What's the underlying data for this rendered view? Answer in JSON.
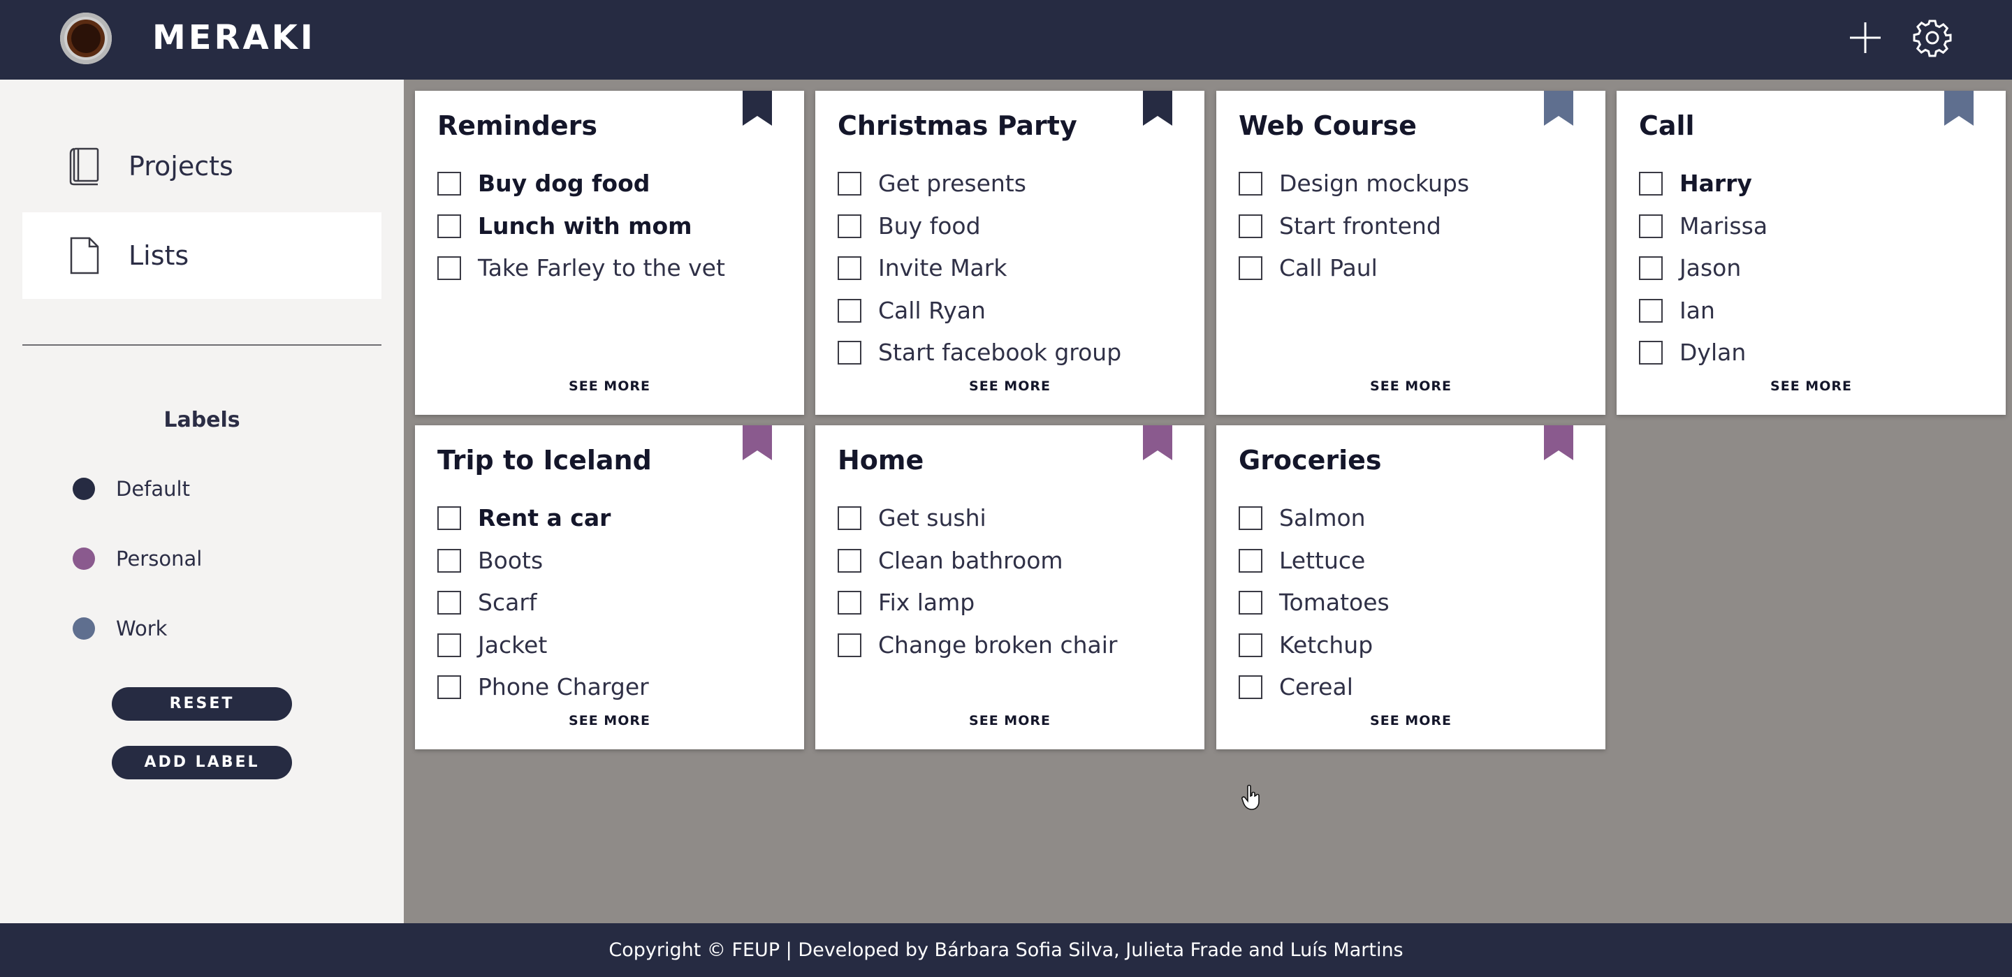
{
  "app": {
    "brand": "MERAKI"
  },
  "header": {
    "add_icon": "plus-icon",
    "settings_icon": "gear-icon"
  },
  "sidebar": {
    "nav": [
      {
        "label": "Projects",
        "icon": "book-icon",
        "active": false
      },
      {
        "label": "Lists",
        "icon": "document-icon",
        "active": true
      }
    ],
    "labels_title": "Labels",
    "labels": [
      {
        "name": "Default",
        "color": "#262b42"
      },
      {
        "name": "Personal",
        "color": "#8a5a8e"
      },
      {
        "name": "Work",
        "color": "#5f6f8f"
      }
    ],
    "reset_label": "RESET",
    "add_label_label": "ADD LABEL"
  },
  "lists": [
    {
      "title": "Reminders",
      "label_color": "#262b42",
      "items": [
        {
          "text": "Buy dog food",
          "bold": true
        },
        {
          "text": "Lunch with mom",
          "bold": true
        },
        {
          "text": "Take Farley to the vet",
          "bold": false
        }
      ],
      "see_more": "SEE MORE"
    },
    {
      "title": "Christmas Party",
      "label_color": "#262b42",
      "items": [
        {
          "text": "Get presents",
          "bold": false
        },
        {
          "text": "Buy food",
          "bold": false
        },
        {
          "text": "Invite Mark",
          "bold": false
        },
        {
          "text": "Call Ryan",
          "bold": false
        },
        {
          "text": "Start facebook group",
          "bold": false
        }
      ],
      "see_more": "SEE MORE"
    },
    {
      "title": "Web Course",
      "label_color": "#5f6f8f",
      "items": [
        {
          "text": "Design mockups",
          "bold": false
        },
        {
          "text": "Start frontend",
          "bold": false
        },
        {
          "text": "Call Paul",
          "bold": false
        }
      ],
      "see_more": "SEE MORE"
    },
    {
      "title": "Call",
      "label_color": "#5f6f8f",
      "items": [
        {
          "text": "Harry",
          "bold": true
        },
        {
          "text": "Marissa",
          "bold": false
        },
        {
          "text": "Jason",
          "bold": false
        },
        {
          "text": "Ian",
          "bold": false
        },
        {
          "text": "Dylan",
          "bold": false
        }
      ],
      "see_more": "SEE MORE"
    },
    {
      "title": "Trip to Iceland",
      "label_color": "#8a5a8e",
      "items": [
        {
          "text": "Rent a car",
          "bold": true
        },
        {
          "text": "Boots",
          "bold": false
        },
        {
          "text": "Scarf",
          "bold": false
        },
        {
          "text": "Jacket",
          "bold": false
        },
        {
          "text": "Phone Charger",
          "bold": false
        }
      ],
      "see_more": "SEE MORE"
    },
    {
      "title": "Home",
      "label_color": "#8a5a8e",
      "items": [
        {
          "text": "Get sushi",
          "bold": false
        },
        {
          "text": "Clean bathroom",
          "bold": false
        },
        {
          "text": "Fix lamp",
          "bold": false
        },
        {
          "text": "Change broken chair",
          "bold": false
        }
      ],
      "see_more": "SEE MORE"
    },
    {
      "title": "Groceries",
      "label_color": "#8a5a8e",
      "items": [
        {
          "text": "Salmon",
          "bold": false
        },
        {
          "text": "Lettuce",
          "bold": false
        },
        {
          "text": "Tomatoes",
          "bold": false
        },
        {
          "text": "Ketchup",
          "bold": false
        },
        {
          "text": "Cereal",
          "bold": false
        }
      ],
      "see_more": "SEE MORE"
    }
  ],
  "footer": {
    "text": "Copyright © FEUP | Developed by Bárbara Sofia Silva, Julieta Frade and Luís Martins"
  }
}
